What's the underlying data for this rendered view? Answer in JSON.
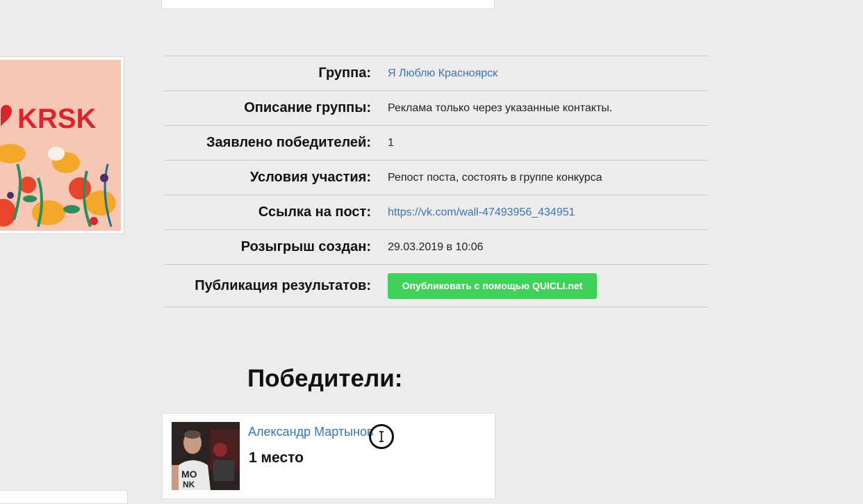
{
  "group_image": {
    "logo_text": "KRSK"
  },
  "info": {
    "rows": [
      {
        "label": "Группа:",
        "value": "Я Люблю Красноярск"
      },
      {
        "label": "Описание группы:",
        "value": "Реклама только через указанные контакты."
      },
      {
        "label": "Заявлено победителей:",
        "value": "1"
      },
      {
        "label": "Условия участия:",
        "value": "Репост поста, состоять в группе конкурса"
      },
      {
        "label": "Ссылка на пост:",
        "value": "https://vk.com/wall-47493956_434951"
      },
      {
        "label": "Розыгрыш создан:",
        "value": "29.03.2019 в 10:06"
      },
      {
        "label": "Публикация результатов:",
        "button": "Опубликовать с помощью QUICLI.net"
      }
    ]
  },
  "winners": {
    "title": "Победители:",
    "items": [
      {
        "name": "Александр Мартынов",
        "place": "1 место"
      }
    ]
  },
  "colors": {
    "link": "#3a73b0",
    "button": "#3fd15a",
    "background": "#ececec"
  }
}
